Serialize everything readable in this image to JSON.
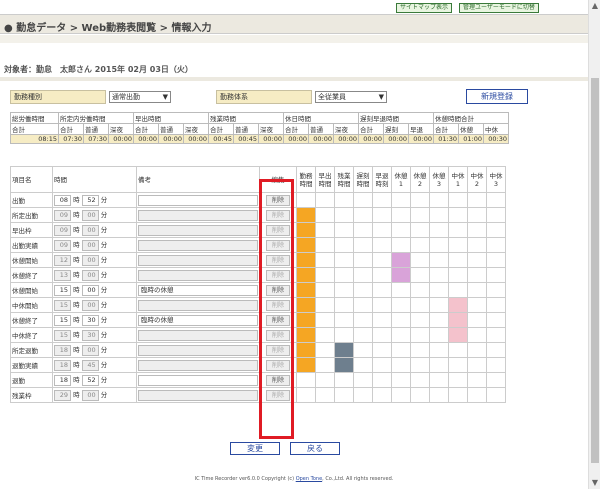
{
  "topbar": {
    "sitemap_label": "サイトマップ表示",
    "admin_label": "管理ユーザーモードに切替"
  },
  "header": {
    "breadcrumb": "● 勤怠データ > Web勤務表閲覧 > 情報入力"
  },
  "target": "対象者：勤怠　太郎さん 2015年 02月 03日（火）",
  "selectors": {
    "kinmu_shubetsu_label": "勤務種別",
    "kinmu_shubetsu_value": "通常出勤",
    "kinmu_taikei_label": "勤務体系",
    "kinmu_taikei_value": "全従業員",
    "new_button": "新規登録"
  },
  "summary": {
    "groups": [
      "総労働時間",
      "所定内労働時間",
      "早出時間",
      "残業時間",
      "休日時間",
      "遅刻早退時間",
      "休憩時間合計"
    ],
    "subheaders": [
      "合計",
      "合計",
      "普通",
      "深夜",
      "合計",
      "普通",
      "深夜",
      "合計",
      "普通",
      "深夜",
      "合計",
      "普通",
      "深夜",
      "合計",
      "遅刻",
      "早退",
      "合計",
      "休憩",
      "中休"
    ],
    "values": [
      "08:15",
      "07:30",
      "07:30",
      "00:00",
      "00:00",
      "00:00",
      "00:00",
      "00:45",
      "00:45",
      "00:00",
      "00:00",
      "00:00",
      "00:00",
      "00:00",
      "00:00",
      "00:00",
      "01:30",
      "01:00",
      "00:30"
    ]
  },
  "grid": {
    "headers": {
      "item": "項目名",
      "time": "時間",
      "note": "備考",
      "edit": "編集",
      "cols": [
        "勤務時間",
        "早出時間",
        "残業時間",
        "遅刻時間",
        "早退時刻",
        "休憩1",
        "休憩2",
        "休憩3",
        "中休1",
        "中休2",
        "中休3"
      ]
    },
    "hour_unit": "時",
    "min_unit": "分",
    "delete_label": "削除",
    "rows": [
      {
        "name": "出勤",
        "h": "08",
        "m": "52",
        "note": "",
        "enabled": true
      },
      {
        "name": "所定出勤",
        "h": "09",
        "m": "00",
        "note": "",
        "enabled": false
      },
      {
        "name": "早出枠",
        "h": "09",
        "m": "00",
        "note": "",
        "enabled": false
      },
      {
        "name": "出勤実績",
        "h": "09",
        "m": "00",
        "note": "",
        "enabled": false
      },
      {
        "name": "休憩開始",
        "h": "12",
        "m": "00",
        "note": "",
        "enabled": false
      },
      {
        "name": "休憩終了",
        "h": "13",
        "m": "00",
        "note": "",
        "enabled": false
      },
      {
        "name": "休憩開始",
        "h": "15",
        "m": "00",
        "note": "臨時の休憩",
        "enabled": true
      },
      {
        "name": "中休開始",
        "h": "15",
        "m": "00",
        "note": "",
        "enabled": false
      },
      {
        "name": "休憩終了",
        "h": "15",
        "m": "30",
        "note": "臨時の休憩",
        "enabled": true
      },
      {
        "name": "中休終了",
        "h": "15",
        "m": "30",
        "note": "",
        "enabled": false
      },
      {
        "name": "所定退勤",
        "h": "18",
        "m": "00",
        "note": "",
        "enabled": false
      },
      {
        "name": "退勤実績",
        "h": "18",
        "m": "45",
        "note": "",
        "enabled": false
      },
      {
        "name": "退勤",
        "h": "18",
        "m": "52",
        "note": "",
        "enabled": true
      },
      {
        "name": "残業枠",
        "h": "29",
        "m": "00",
        "note": "",
        "enabled": false
      }
    ]
  },
  "colors": {
    "work": "#f5a623",
    "break": "#d9a3d9",
    "midbreak": "#f4c2cc",
    "overtime": "#6e7f8e",
    "highlight": "#e01b24"
  },
  "buttons": {
    "change": "変更",
    "back": "戻る"
  },
  "footer": {
    "prefix": "IC Time Recorder ver6.0.0 Copyright (c) ",
    "link": "Open Tone",
    "suffix": ", Co.,Ltd. All rights reserved."
  }
}
